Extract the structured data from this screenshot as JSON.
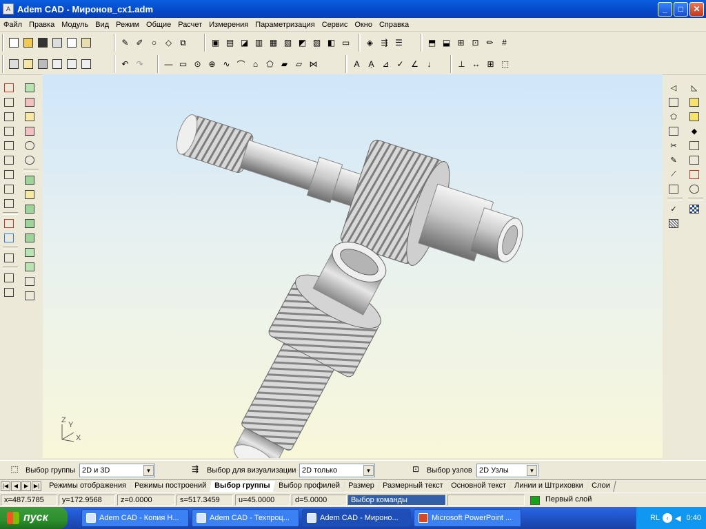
{
  "window": {
    "app_icon": "adem-cad-icon",
    "title": "Adem CAD - Миронов_сх1.adm",
    "minimize": "_",
    "maximize": "□",
    "close": "✕"
  },
  "menu": [
    "Файл",
    "Правка",
    "Модуль",
    "Вид",
    "Режим",
    "Общие",
    "Расчет",
    "Измерения",
    "Параметризация",
    "Сервис",
    "Окно",
    "Справка"
  ],
  "viewport": {
    "axes_labels": {
      "z": "Z",
      "y": "Y",
      "x": "X"
    }
  },
  "selection_panel": {
    "group_label": "Выбор группы",
    "group_value": "2D и 3D",
    "visual_label": "Выбор для визуализации",
    "visual_value": "2D только",
    "nodes_label": "Выбор узлов",
    "nodes_value": "2D Узлы"
  },
  "tabs": [
    {
      "label": "Режимы отображения",
      "active": false
    },
    {
      "label": "Режимы построений",
      "active": false
    },
    {
      "label": "Выбор группы",
      "active": true
    },
    {
      "label": "Выбор профилей",
      "active": false
    },
    {
      "label": "Размер",
      "active": false
    },
    {
      "label": "Размерный текст",
      "active": false
    },
    {
      "label": "Основной текст",
      "active": false
    },
    {
      "label": "Линии и Штриховки",
      "active": false
    },
    {
      "label": "Слои",
      "active": false
    }
  ],
  "status": {
    "x": "x=487.5785",
    "y": "y=172.9568",
    "z": "z=0.0000",
    "s": "s=517.3459",
    "u": "u=45.0000",
    "d": "d=5.0000",
    "command": "Выбор команды",
    "layer": "Первый слой",
    "layer_color": "#1aa21a"
  },
  "taskbar": {
    "start": "пуск",
    "tasks": [
      {
        "label": "Adem CAD - Копия Н...",
        "active": false
      },
      {
        "label": "Adem CAD - Техпроц...",
        "active": false
      },
      {
        "label": "Adem CAD - Мироно...",
        "active": true
      },
      {
        "label": "Microsoft PowerPoint ...",
        "active": false
      }
    ],
    "lang": "RL",
    "time": "0:40"
  }
}
